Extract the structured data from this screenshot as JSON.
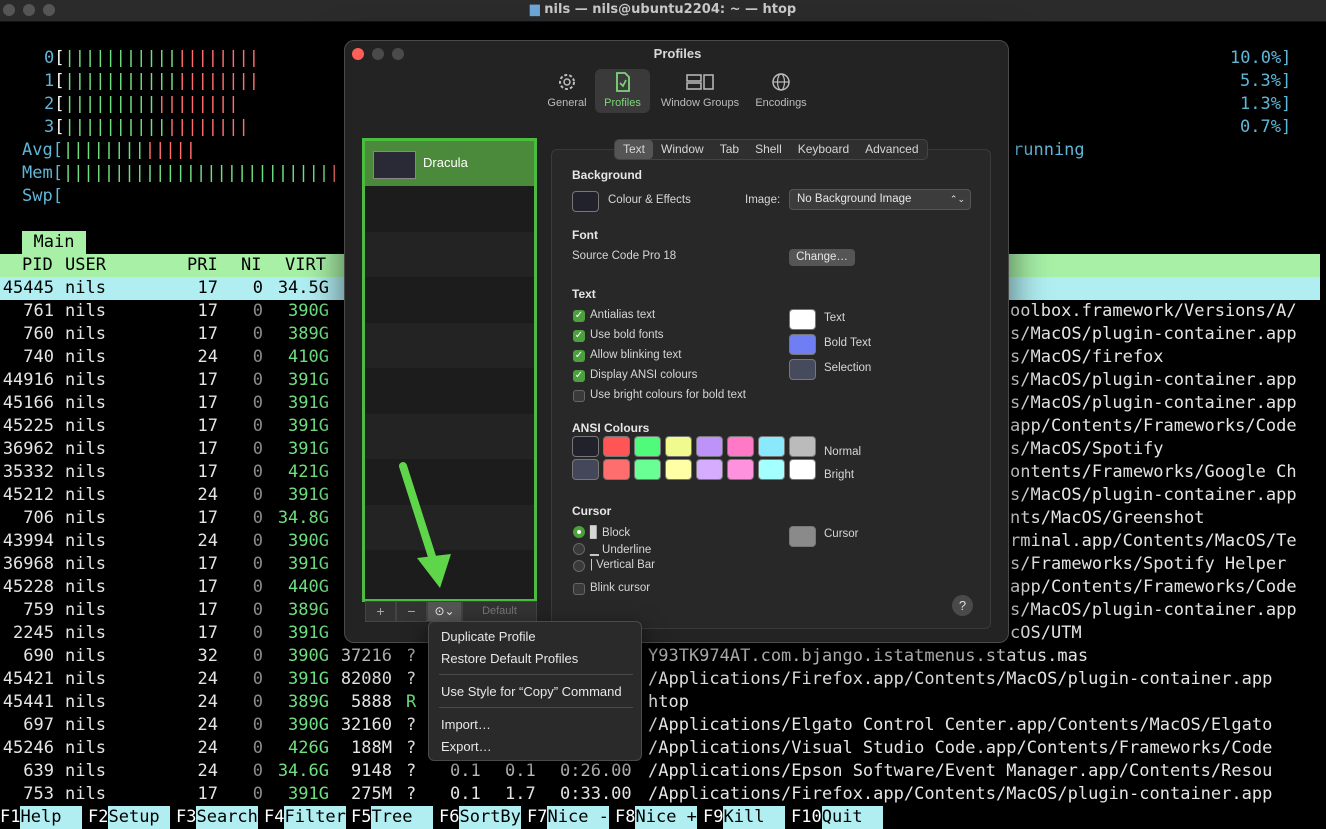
{
  "window": {
    "title": "nils — nils@ubuntu2204: ~ — htop"
  },
  "htop": {
    "cpus": [
      {
        "id": "0",
        "pct": "10.0%]"
      },
      {
        "id": "1",
        "pct": "5.3%]"
      },
      {
        "id": "2",
        "pct": "1.3%]"
      },
      {
        "id": "3",
        "pct": "0.7%]"
      }
    ],
    "avg_label": "Avg[",
    "mem_label": "Mem[",
    "swp_label": "Swp[",
    "running_text": "running",
    "main_tab": "Main",
    "columns": {
      "pid": "PID",
      "user": "USER",
      "pri": "PRI",
      "ni": "NI",
      "virt": "VIRT"
    },
    "rows": [
      {
        "pid": "45445",
        "user": "nils",
        "pri": "17",
        "ni": "0",
        "virt": "34.5G",
        "tail": ""
      },
      {
        "pid": "761",
        "user": "nils",
        "pri": "17",
        "ni": "0",
        "virt": "390G",
        "tail": "oolbox.framework/Versions/A/"
      },
      {
        "pid": "760",
        "user": "nils",
        "pri": "17",
        "ni": "0",
        "virt": "389G",
        "tail": "s/MacOS/plugin-container.app"
      },
      {
        "pid": "740",
        "user": "nils",
        "pri": "24",
        "ni": "0",
        "virt": "410G",
        "tail": "s/MacOS/firefox"
      },
      {
        "pid": "44916",
        "user": "nils",
        "pri": "17",
        "ni": "0",
        "virt": "391G",
        "tail": "s/MacOS/plugin-container.app"
      },
      {
        "pid": "45166",
        "user": "nils",
        "pri": "17",
        "ni": "0",
        "virt": "391G",
        "tail": "s/MacOS/plugin-container.app"
      },
      {
        "pid": "45225",
        "user": "nils",
        "pri": "17",
        "ni": "0",
        "virt": "391G",
        "tail": "app/Contents/Frameworks/Code"
      },
      {
        "pid": "36962",
        "user": "nils",
        "pri": "17",
        "ni": "0",
        "virt": "391G",
        "tail": "s/MacOS/Spotify"
      },
      {
        "pid": "35332",
        "user": "nils",
        "pri": "17",
        "ni": "0",
        "virt": "421G",
        "tail": "ontents/Frameworks/Google Ch"
      },
      {
        "pid": "45212",
        "user": "nils",
        "pri": "24",
        "ni": "0",
        "virt": "391G",
        "tail": "s/MacOS/plugin-container.app"
      },
      {
        "pid": "706",
        "user": "nils",
        "pri": "17",
        "ni": "0",
        "virt": "34.8G",
        "tail": "nts/MacOS/Greenshot"
      },
      {
        "pid": "43994",
        "user": "nils",
        "pri": "24",
        "ni": "0",
        "virt": "390G",
        "tail": "rminal.app/Contents/MacOS/Te"
      },
      {
        "pid": "36968",
        "user": "nils",
        "pri": "17",
        "ni": "0",
        "virt": "391G",
        "tail": "s/Frameworks/Spotify Helper"
      },
      {
        "pid": "45228",
        "user": "nils",
        "pri": "17",
        "ni": "0",
        "virt": "440G",
        "tail": "app/Contents/Frameworks/Code"
      },
      {
        "pid": "759",
        "user": "nils",
        "pri": "17",
        "ni": "0",
        "virt": "389G",
        "tail": "s/MacOS/plugin-container.app"
      },
      {
        "pid": "2245",
        "user": "nils",
        "pri": "17",
        "ni": "0",
        "virt": "391G",
        "tail": "cOS/UTM"
      },
      {
        "pid": "690",
        "user": "nils",
        "pri": "32",
        "ni": "0",
        "virt": "390G",
        "res": "37216",
        "s": "?",
        "tail": "Y93TK974AT.com.bjango.istatmenus.status.mas"
      },
      {
        "pid": "45421",
        "user": "nils",
        "pri": "24",
        "ni": "0",
        "virt": "391G",
        "res": "82080",
        "s": "?",
        "tail": "/Applications/Firefox.app/Contents/MacOS/plugin-container.app"
      },
      {
        "pid": "45441",
        "user": "nils",
        "pri": "24",
        "ni": "0",
        "virt": "389G",
        "res": "5888",
        "s": "R",
        "tail": "htop"
      },
      {
        "pid": "697",
        "user": "nils",
        "pri": "24",
        "ni": "0",
        "virt": "390G",
        "res": "32160",
        "s": "?",
        "tail": "/Applications/Elgato Control Center.app/Contents/MacOS/Elgato"
      },
      {
        "pid": "45246",
        "user": "nils",
        "pri": "24",
        "ni": "0",
        "virt": "426G",
        "res": "188M",
        "s": "?",
        "tail": "/Applications/Visual Studio Code.app/Contents/Frameworks/Code"
      },
      {
        "pid": "639",
        "user": "nils",
        "pri": "24",
        "ni": "0",
        "virt": "34.6G",
        "res": "9148",
        "s": "?",
        "cpu": "0.1",
        "mem": "0.1",
        "time": "0:26.00",
        "tail": "/Applications/Epson Software/Event Manager.app/Contents/Resou"
      },
      {
        "pid": "753",
        "user": "nils",
        "pri": "17",
        "ni": "0",
        "virt": "391G",
        "res": "275M",
        "s": "?",
        "cpu": "0.1",
        "mem": "1.7",
        "time": "0:33.00",
        "tail": "/Applications/Firefox.app/Contents/MacOS/plugin-container.app"
      }
    ],
    "fkeys": [
      {
        "k": "F1",
        "l": "Help  "
      },
      {
        "k": "F2",
        "l": "Setup "
      },
      {
        "k": "F3",
        "l": "Search"
      },
      {
        "k": "F4",
        "l": "Filter"
      },
      {
        "k": "F5",
        "l": "Tree  "
      },
      {
        "k": "F6",
        "l": "SortBy"
      },
      {
        "k": "F7",
        "l": "Nice -"
      },
      {
        "k": "F8",
        "l": "Nice +"
      },
      {
        "k": "F9",
        "l": "Kill  "
      },
      {
        "k": "F10",
        "l": "Quit  "
      }
    ]
  },
  "profiles": {
    "title": "Profiles",
    "toolbar": [
      {
        "label": "General",
        "icon": "gear-icon"
      },
      {
        "label": "Profiles",
        "icon": "profiles-icon"
      },
      {
        "label": "Window Groups",
        "icon": "window-groups-icon"
      },
      {
        "label": "Encodings",
        "icon": "globe-icon"
      }
    ],
    "list": [
      "Dracula"
    ],
    "buttons": {
      "add": "+",
      "remove": "−",
      "more": "⊙⌄",
      "default": "Default"
    },
    "tabs": [
      "Text",
      "Window",
      "Tab",
      "Shell",
      "Keyboard",
      "Advanced"
    ],
    "background": {
      "heading": "Background",
      "colour_effects": "Colour & Effects",
      "image_label": "Image:",
      "image_value": "No Background Image"
    },
    "font": {
      "heading": "Font",
      "value": "Source Code Pro 18",
      "change": "Change…"
    },
    "text": {
      "heading": "Text",
      "options": [
        {
          "label": "Antialias text",
          "checked": true
        },
        {
          "label": "Use bold fonts",
          "checked": true
        },
        {
          "label": "Allow blinking text",
          "checked": true
        },
        {
          "label": "Display ANSI colours",
          "checked": true
        },
        {
          "label": "Use bright colours for bold text",
          "checked": false
        }
      ],
      "colors": [
        {
          "label": "Text",
          "color": "#ffffff"
        },
        {
          "label": "Bold Text",
          "color": "#6f7ff3"
        },
        {
          "label": "Selection",
          "color": "#454a5c"
        }
      ]
    },
    "ansi": {
      "heading": "ANSI Colours",
      "normal_label": "Normal",
      "bright_label": "Bright",
      "normal": [
        "#21222c",
        "#ff5555",
        "#50fa7b",
        "#f1fa8c",
        "#bd93f9",
        "#ff79c6",
        "#8be9fd",
        "#bbbbbb"
      ],
      "bright": [
        "#44475a",
        "#ff6e6e",
        "#69ff94",
        "#ffffa5",
        "#d6acff",
        "#ff92df",
        "#a4ffff",
        "#ffffff"
      ]
    },
    "cursor": {
      "heading": "Cursor",
      "options": [
        {
          "label": "▊ Block",
          "on": true
        },
        {
          "label": "▁ Underline",
          "on": false
        },
        {
          "label": "| Vertical Bar",
          "on": false
        }
      ],
      "blink": "Blink cursor",
      "color_label": "Cursor",
      "color": "#8a8a8a"
    },
    "help": "?"
  },
  "menu": {
    "items": [
      "Duplicate Profile",
      "Restore Default Profiles",
      "Use Style for “Copy” Command",
      "Import…",
      "Export…"
    ]
  },
  "colors": {
    "accent": "#4bbc40",
    "selection_row": "#b0eef2",
    "header_bg": "#a7f0a6"
  }
}
